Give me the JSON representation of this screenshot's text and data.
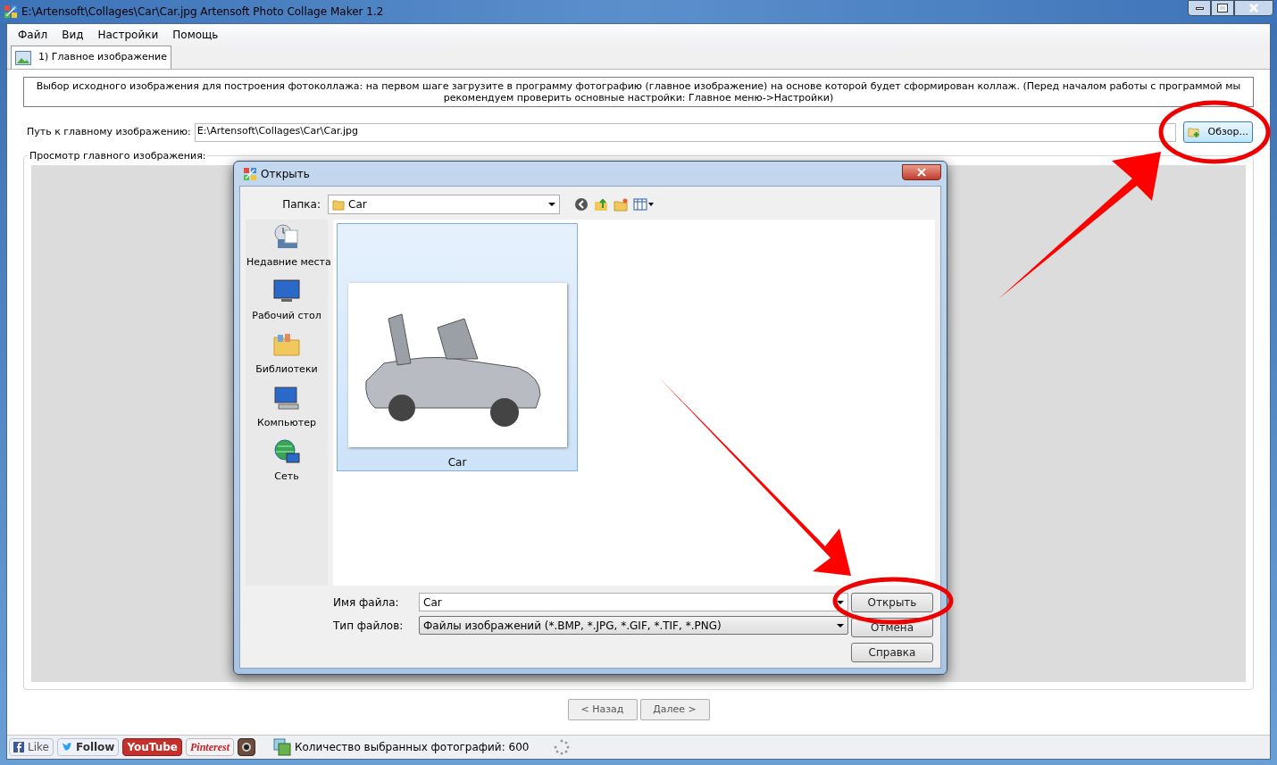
{
  "window": {
    "title": "E:\\Artensoft\\Collages\\Car\\Car.jpg Artensoft Photo Collage Maker 1.2"
  },
  "menu": [
    "Файл",
    "Вид",
    "Настройки",
    "Помощь"
  ],
  "tabs": [
    {
      "label": "1) Главное изображение",
      "selected": true
    }
  ],
  "description": "Выбор исходного изображения для построения фотоколлажа: на первом шаге загрузите в программу фотографию (главное изображение) на основе которой будет сформирован коллаж. (Перед началом работы с программой мы рекомендуем проверить основные настройки: Главное меню->Настройки)",
  "path": {
    "label": "Путь к главному изображению:",
    "value": "E:\\Artensoft\\Collages\\Car\\Car.jpg",
    "browse": "Обзор..."
  },
  "preview": {
    "label": "Просмотр главного изображения:"
  },
  "nav": [
    "< Назад",
    "Далее >"
  ],
  "status_bar": {
    "social": [
      {
        "kind": "facebook",
        "label": "Like"
      },
      {
        "kind": "twitter",
        "label": "Follow"
      },
      {
        "kind": "youtube",
        "label": "YouTube"
      },
      {
        "kind": "pinterest",
        "label": "Pinterest"
      },
      {
        "kind": "instagram"
      }
    ],
    "count": "Количество выбранных фотографий: 600"
  },
  "dialog": {
    "title": "Открыть",
    "folder_label": "Папка:",
    "folder": "Car",
    "places": [
      {
        "kind": "recent",
        "label": "Недавние места"
      },
      {
        "kind": "desktop",
        "label": "Рабочий стол"
      },
      {
        "kind": "libraries",
        "label": "Библиотеки"
      },
      {
        "kind": "computer",
        "label": "Компьютер"
      },
      {
        "kind": "network",
        "label": "Сеть"
      }
    ],
    "files": [
      {
        "name": "Car",
        "selected": true
      }
    ],
    "filename_label": "Имя файла:",
    "filename": "Car",
    "filetype_label": "Тип файлов:",
    "filetype": "Файлы изображений (*.BMP, *.JPG, *.GIF, *.TIF, *.PNG)",
    "buttons": [
      "Открыть",
      "Отмена",
      "Справка"
    ]
  }
}
